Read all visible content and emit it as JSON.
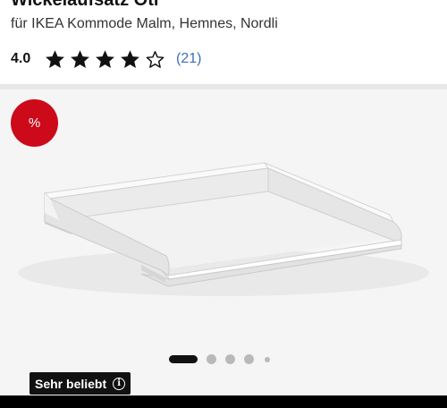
{
  "product": {
    "title": "Wickelaufsatz Oti",
    "subtitle": "für IKEA Kommode Malm, Hemnes, Nordli"
  },
  "rating": {
    "value_label": "4.0",
    "value": 4.0,
    "max": 5,
    "review_count_label": "(21)",
    "star_color": "#111111"
  },
  "image_gallery": {
    "discount_badge": "%",
    "badge_color": "#cc0a1a",
    "popular_label": "Sehr beliebt",
    "info_icon": "info-icon",
    "carousel": {
      "total": 5,
      "active": 1
    }
  }
}
